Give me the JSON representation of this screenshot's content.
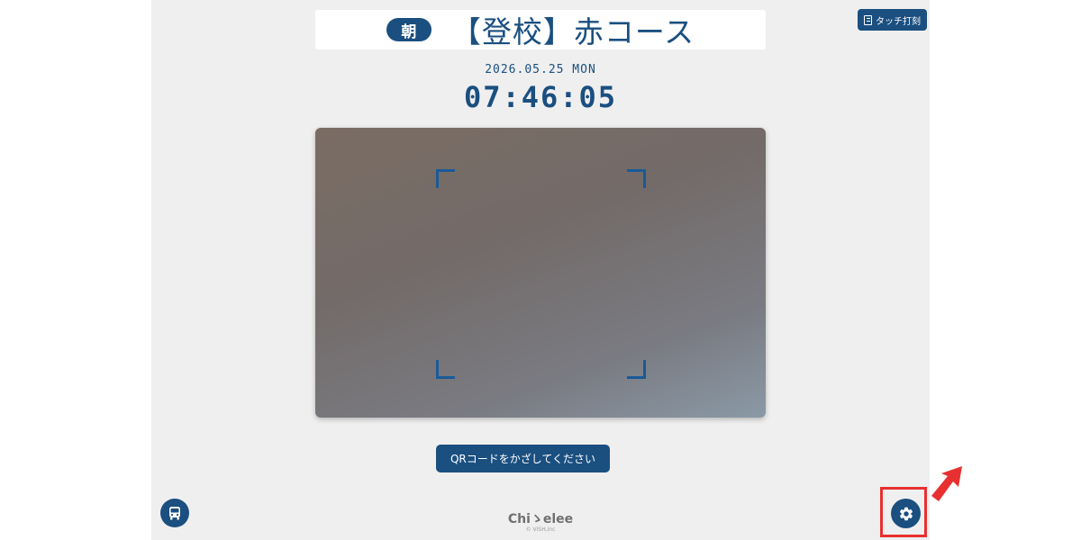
{
  "header": {
    "period_badge": "朝",
    "course_title": "【登校】赤コース"
  },
  "toolbar": {
    "touch_label": "タッチ打刻",
    "touch_icon": "document-icon"
  },
  "clock": {
    "date": "2026.05.25 MON",
    "time": "07:46:05"
  },
  "scanner": {
    "instruction": "QRコードをかざしてください"
  },
  "footer": {
    "logo": "Chiゝelee",
    "copyright": "© VISH,inc",
    "bus_icon": "bus-icon",
    "settings_icon": "gear-icon"
  },
  "colors": {
    "primary": "#1a4f80",
    "background": "#efefef",
    "annotation": "#e83030"
  }
}
